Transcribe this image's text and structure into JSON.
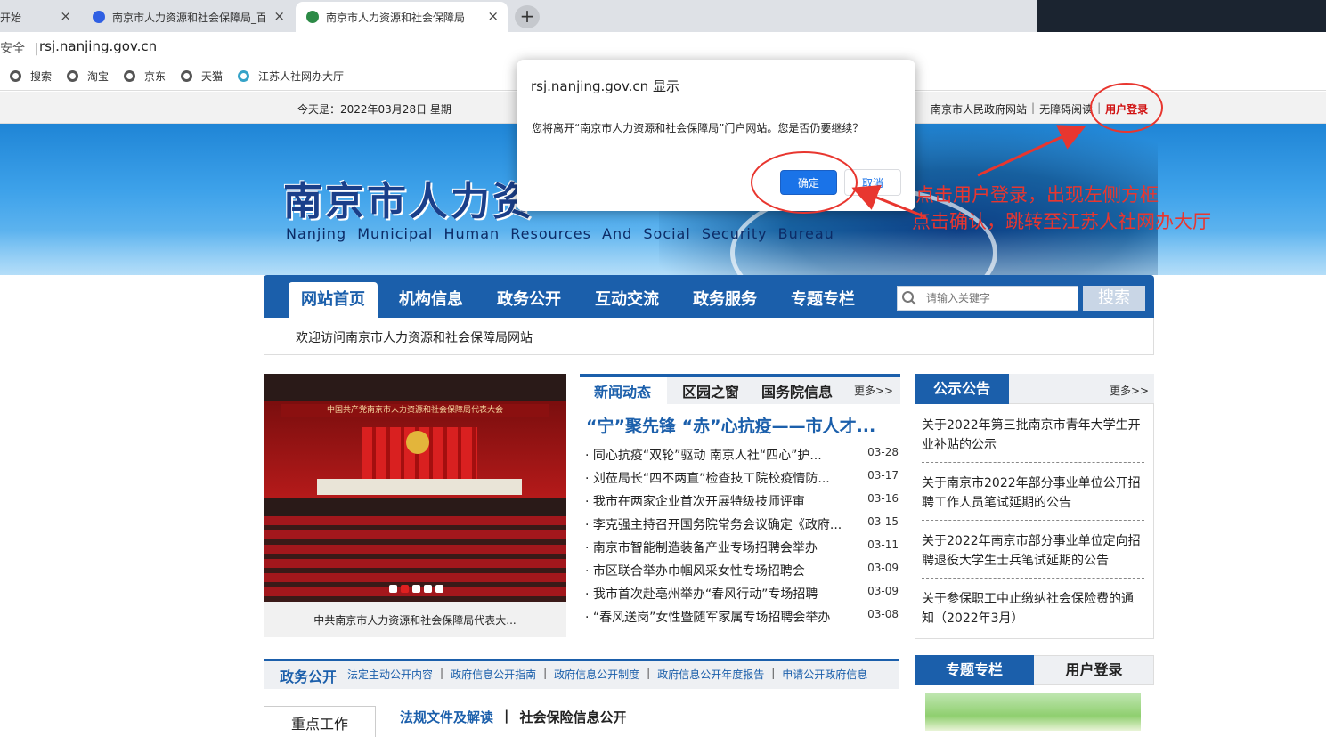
{
  "browser": {
    "tabs": [
      {
        "title": "开始",
        "active": false
      },
      {
        "title": "南京市人力资源和社会保障局_百",
        "active": false
      },
      {
        "title": "南京市人力资源和社会保障局",
        "active": true
      }
    ],
    "new_tab": "+",
    "close_glyph": "×",
    "address": {
      "security": "安全",
      "url": "rsj.nanjing.gov.cn"
    },
    "bookmarks": [
      {
        "label": "搜索",
        "icon": "globe-icon"
      },
      {
        "label": "淘宝",
        "icon": "globe-icon"
      },
      {
        "label": "京东",
        "icon": "globe-icon"
      },
      {
        "label": "天猫",
        "icon": "globe-icon"
      },
      {
        "label": "江苏人社网办大厅",
        "icon": "jiangsu-hrss-icon"
      }
    ]
  },
  "site_bar": {
    "today": "今天是：2022年03月28日 星期一",
    "links": {
      "gov": "南京市人民政府网站",
      "accessible": "无障碍阅读",
      "login": "用户登录"
    },
    "separator": "|"
  },
  "banner": {
    "name_cn": "南京市人力资",
    "name_en": "Nanjing Municipal Human Resources And Social Security Bureau"
  },
  "nav": {
    "items": [
      {
        "label": "网站首页",
        "active": true
      },
      {
        "label": "机构信息"
      },
      {
        "label": "政务公开"
      },
      {
        "label": "互动交流"
      },
      {
        "label": "政务服务"
      },
      {
        "label": "专题专栏"
      }
    ],
    "search_placeholder": "请输入关键字",
    "search_button": "搜索",
    "welcome": "欢迎访问南京市人力资源和社会保障局网站"
  },
  "photo": {
    "banner_text": "中国共产党南京市人力资源和社会保障局代表大会",
    "caption": "中共南京市人力资源和社会保障局代表大..."
  },
  "news": {
    "tabs": [
      "新闻动态",
      "区园之窗",
      "国务院信息"
    ],
    "more": "更多>>",
    "headline": "“宁”聚先锋 “赤”心抗疫——市人才...",
    "items": [
      {
        "title": "· 同心抗疫“双轮”驱动 南京人社“四心”护...",
        "date": "03-28"
      },
      {
        "title": "· 刘莅局长“四不两直”检查技工院校疫情防...",
        "date": "03-17"
      },
      {
        "title": "· 我市在两家企业首次开展特级技师评审",
        "date": "03-16"
      },
      {
        "title": "· 李克强主持召开国务院常务会议确定《政府...",
        "date": "03-15"
      },
      {
        "title": "· 南京市智能制造装备产业专场招聘会举办",
        "date": "03-11"
      },
      {
        "title": "· 市区联合举办巾帼风采女性专场招聘会",
        "date": "03-09"
      },
      {
        "title": "· 我市首次赴亳州举办“春风行动”专场招聘",
        "date": "03-09"
      },
      {
        "title": "· “春风送岗”女性暨随军家属专场招聘会举办",
        "date": "03-08"
      }
    ]
  },
  "notices": {
    "title": "公示公告",
    "more": "更多>>",
    "items": [
      "关于2022年第三批南京市青年大学生开业补贴的公示",
      "关于南京市2022年部分事业单位公开招聘工作人员笔试延期的公告",
      "关于2022年南京市部分事业单位定向招聘退役大学生士兵笔试延期的公告",
      "关于参保职工中止缴纳社会保险费的通知（2022年3月）"
    ]
  },
  "gov_open": {
    "title": "政务公开",
    "links": [
      "法定主动公开内容",
      "政府信息公开指南",
      "政府信息公开制度",
      "政府信息公开年度报告",
      "申请公开政府信息"
    ],
    "separator": "|"
  },
  "bottom": {
    "key_work": "重点工作",
    "law_links": [
      "法规文件及解读",
      "社会保险信息公开"
    ],
    "separator": "|",
    "special_tab": "专题专栏",
    "user_login_tab": "用户登录"
  },
  "dialog": {
    "title": "rsj.nanjing.gov.cn 显示",
    "message": "您将离开“南京市人力资源和社会保障局”门户网站。您是否仍要继续？",
    "ok": "确定",
    "cancel": "取消"
  },
  "annotations": {
    "line1": "点击用户登录，出现左侧方框",
    "line2": "点击确认，跳转至江苏人社网办大厅",
    "color": "#e8362f"
  }
}
